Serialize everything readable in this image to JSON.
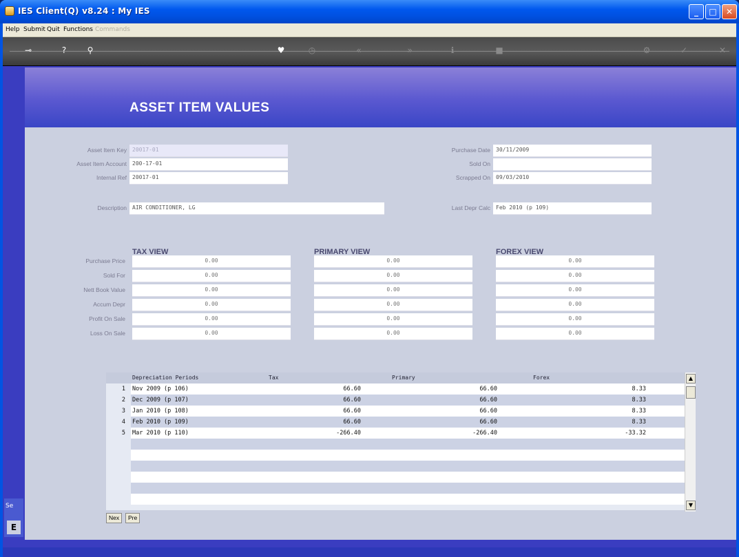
{
  "window": {
    "title": "IES Client(Q) v8.24 : My IES"
  },
  "menu": {
    "help": "Help",
    "submit": "Submit",
    "quit": "Quit",
    "functions": "Functions",
    "commands": "Commands"
  },
  "toolbar": {
    "icons": [
      "key-icon",
      "help-icon",
      "search-icon",
      "heart-icon",
      "clock-icon",
      "rewind-icon",
      "forward-icon",
      "info-icon",
      "stop-icon",
      "settings-icon",
      "check-icon",
      "close-icon"
    ]
  },
  "page": {
    "title": "ASSET ITEM VALUES"
  },
  "fields": {
    "asset_item_key": {
      "label": "Asset Item Key",
      "value": "20017-01"
    },
    "asset_item_account": {
      "label": "Asset Item Account",
      "value": "200-17-01"
    },
    "internal_ref": {
      "label": "Internal Ref",
      "value": "20017-01"
    },
    "description": {
      "label": "Description",
      "value": "AIR CONDITIONER, LG"
    },
    "purchase_date": {
      "label": "Purchase Date",
      "value": "30/11/2009"
    },
    "sold_on": {
      "label": "Sold On",
      "value": ""
    },
    "scrapped_on": {
      "label": "Scrapped On",
      "value": "09/03/2010"
    },
    "last_depr_calc": {
      "label": "Last Depr Calc",
      "value": "Feb 2010 (p 109)"
    }
  },
  "views": {
    "tax_title": "TAX VIEW",
    "primary_title": "PRIMARY VIEW",
    "forex_title": "FOREX VIEW",
    "row_labels": [
      "Purchase Price",
      "Sold For",
      "Nett Book Value",
      "Accum Depr",
      "Profit On Sale",
      "Loss On Sale"
    ],
    "tax": [
      "0.00",
      "0.00",
      "0.00",
      "0.00",
      "0.00",
      "0.00"
    ],
    "primary": [
      "0.00",
      "0.00",
      "0.00",
      "0.00",
      "0.00",
      "0.00"
    ],
    "forex": [
      "0.00",
      "0.00",
      "0.00",
      "0.00",
      "0.00",
      "0.00"
    ]
  },
  "grid": {
    "headers": {
      "period": "Depreciation Periods",
      "tax": "Tax",
      "primary": "Primary",
      "forex": "Forex"
    },
    "rows": [
      {
        "n": "1",
        "period": "Nov 2009 (p 106)",
        "tax": "66.60",
        "primary": "66.60",
        "forex": "8.33"
      },
      {
        "n": "2",
        "period": "Dec 2009 (p 107)",
        "tax": "66.60",
        "primary": "66.60",
        "forex": "8.33"
      },
      {
        "n": "3",
        "period": "Jan 2010 (p 108)",
        "tax": "66.60",
        "primary": "66.60",
        "forex": "8.33"
      },
      {
        "n": "4",
        "period": "Feb 2010 (p 109)",
        "tax": "66.60",
        "primary": "66.60",
        "forex": "8.33"
      },
      {
        "n": "5",
        "period": "Mar 2010 (p 110)",
        "tax": "-266.40",
        "primary": "-266.40",
        "forex": "-33.32"
      }
    ]
  },
  "pager": {
    "next": "Nex",
    "prev": "Pre"
  },
  "side": {
    "label": "Se",
    "icon": "E"
  }
}
